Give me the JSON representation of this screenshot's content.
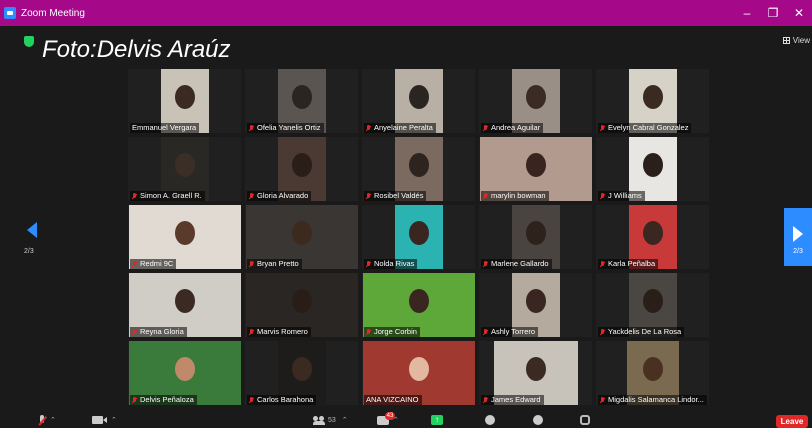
{
  "window": {
    "title": "Zoom Meeting",
    "controls": [
      "minimize",
      "maximize",
      "close"
    ]
  },
  "header": {
    "watermark": "Foto:Delvis Araúz",
    "view_label": "View"
  },
  "pagination": {
    "left": "2/3",
    "right": "2/3"
  },
  "participants": [
    {
      "name": "Emmanuel Vergara",
      "muted": false
    },
    {
      "name": "Ofelia Yanelis Ortiz",
      "muted": true
    },
    {
      "name": "Anyelaine Peralta",
      "muted": true
    },
    {
      "name": "Andrea Aguilar",
      "muted": true
    },
    {
      "name": "Evelyn Cabral Gonzalez",
      "muted": true
    },
    {
      "name": "Simon A. Graell R.",
      "muted": true
    },
    {
      "name": "Gloria Alvarado",
      "muted": true
    },
    {
      "name": "Rosibel Valdés",
      "muted": true
    },
    {
      "name": "marylin bowman",
      "muted": true
    },
    {
      "name": "J Williams",
      "muted": true
    },
    {
      "name": "Redmi 9C",
      "muted": true
    },
    {
      "name": "Bryan Pretto",
      "muted": true
    },
    {
      "name": "Nolda Rivas",
      "muted": true
    },
    {
      "name": "Marlene Gallardo",
      "muted": true
    },
    {
      "name": "Karla Peñalba",
      "muted": true
    },
    {
      "name": "Reyna Gloria",
      "muted": true
    },
    {
      "name": "Marvis Romero",
      "muted": true
    },
    {
      "name": "Jorge Corbin",
      "muted": true
    },
    {
      "name": "Ashly Torrero",
      "muted": true
    },
    {
      "name": "Yackdelis De La Rosa",
      "muted": true
    },
    {
      "name": "Delvis Peñaloza",
      "muted": true
    },
    {
      "name": "Carlos Barahona",
      "muted": true
    },
    {
      "name": "ANA VIZCAINO",
      "muted": false
    },
    {
      "name": "James Edward",
      "muted": true
    },
    {
      "name": "Migdalis Salamanca Lindor...",
      "muted": true
    }
  ],
  "toolbar": {
    "participants_count": "53",
    "chat_badge": "43",
    "leave_label": "Leave"
  },
  "colors": {
    "titlebar": "#a5098a",
    "accent": "#2d8cff",
    "muted_icon": "#e02828",
    "share": "#23d160",
    "leave": "#e02828"
  }
}
